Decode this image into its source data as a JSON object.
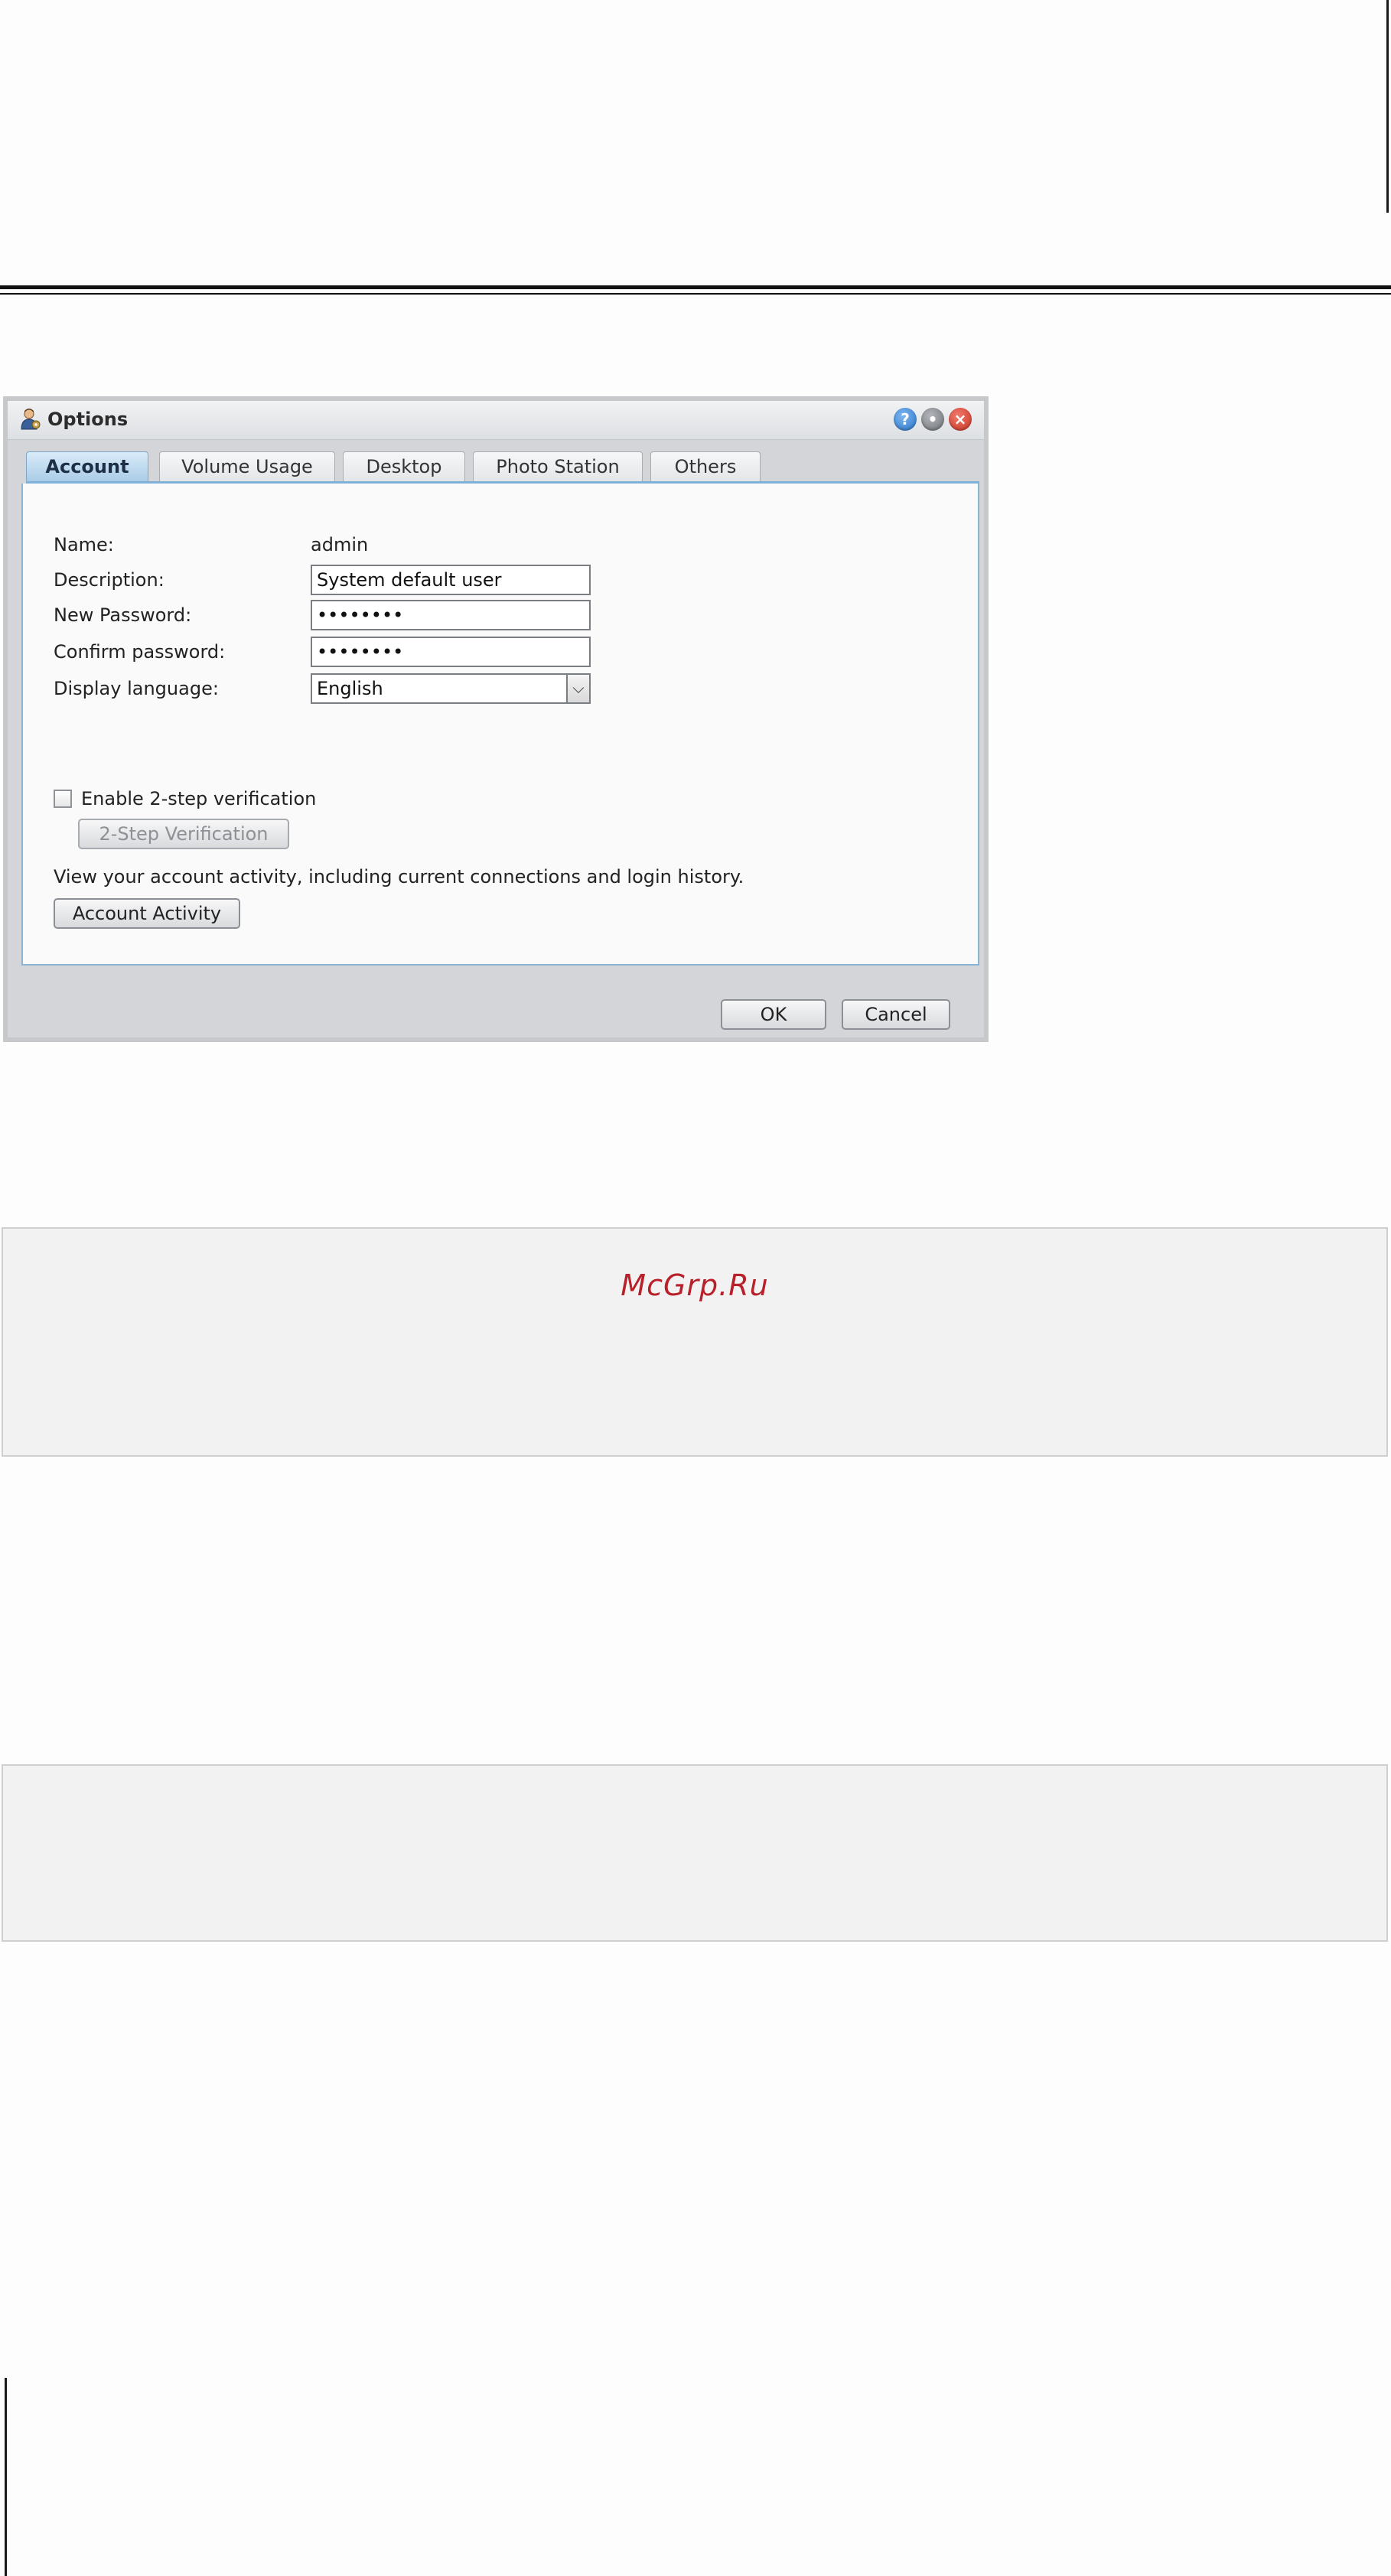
{
  "dialog": {
    "title": "Options",
    "title_icon": "user-settings-icon",
    "window_buttons": {
      "help": "?",
      "minimize": "•",
      "close": "×"
    },
    "tabs": [
      {
        "label": "Account",
        "active": true
      },
      {
        "label": "Volume Usage",
        "active": false
      },
      {
        "label": "Desktop",
        "active": false
      },
      {
        "label": "Photo Station",
        "active": false
      },
      {
        "label": "Others",
        "active": false
      }
    ],
    "account": {
      "name_label": "Name:",
      "name_value": "admin",
      "description_label": "Description:",
      "description_value": "System default user",
      "new_password_label": "New Password:",
      "new_password_value": "••••••••",
      "confirm_password_label": "Confirm password:",
      "confirm_password_value": "••••••••",
      "display_language_label": "Display language:",
      "display_language_value": "English",
      "two_step_checkbox_label": "Enable 2-step verification",
      "two_step_button": "2-Step Verification",
      "activity_text": "View your account activity, including current connections and login history.",
      "activity_button": "Account Activity"
    },
    "footer": {
      "ok": "OK",
      "cancel": "Cancel"
    }
  },
  "watermark": "McGrp.Ru",
  "colors": {
    "active_tab": "#a9cbe7",
    "panel_border": "#8ab4d2",
    "watermark": "#b8202a",
    "close_button": "#c93222",
    "help_button": "#2a74c9"
  }
}
